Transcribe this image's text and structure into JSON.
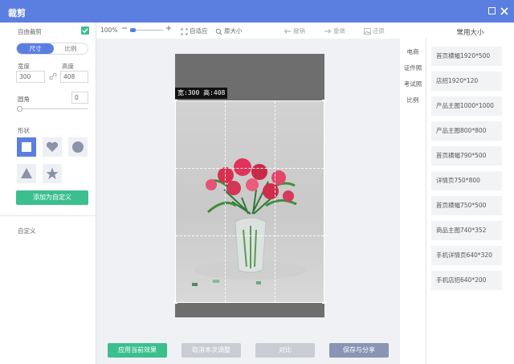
{
  "window": {
    "title": "裁剪"
  },
  "left": {
    "free_crop_label": "自由裁剪",
    "free_crop_checked": true,
    "seg_size": "尺寸",
    "seg_ratio": "比例",
    "width_label": "宽度",
    "height_label": "高度",
    "width_value": "300",
    "height_value": "408",
    "radius_label": "圆角",
    "radius_value": "0",
    "radius_level": 0,
    "shape_label": "形状",
    "shapes": [
      "square-icon",
      "heart-icon",
      "circle-icon",
      "triangle-icon",
      "star-icon"
    ],
    "add_custom": "添加为自定义",
    "custom_label": "自定义"
  },
  "toolbar": {
    "zoom_value": "100%",
    "fit": "自适应",
    "original": "原大小",
    "undo": "撤销",
    "redo": "重做",
    "restore": "还原"
  },
  "canvas": {
    "size_tag": "宽:300 高:408"
  },
  "bottom": {
    "apply": "应用当前效果",
    "cancel": "取消本次调整",
    "compare": "对比",
    "save": "保存与分享"
  },
  "tabs": [
    "电商",
    "证件照",
    "考试照",
    "比例"
  ],
  "right": {
    "title": "常用大小",
    "sizes": [
      "首页横幅1920*500",
      "店招1920*120",
      "产品主图1000*1000",
      "产品主图800*800",
      "首页横幅790*500",
      "详情页750*800",
      "首页横幅750*500",
      "商品主图740*352",
      "手机详情页640*320",
      "手机店招640*200"
    ]
  },
  "colors": {
    "accent": "#5b7fe0",
    "green": "#3bbf8f",
    "disabled": "#c9ccd3",
    "save": "#8a94b4"
  }
}
